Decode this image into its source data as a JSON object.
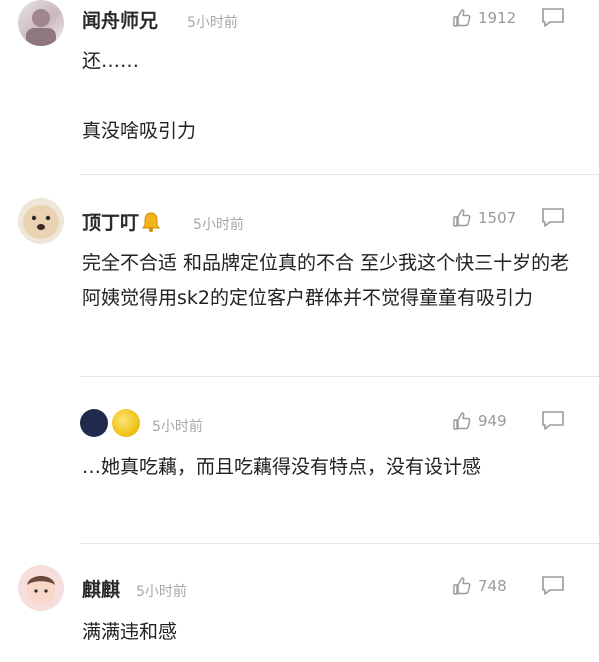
{
  "comments": [
    {
      "username": "闻舟师兄",
      "time": "5小时前",
      "likes": "1912",
      "text": [
        "还……",
        "真没啥吸引力"
      ]
    },
    {
      "username": "顶丁叮",
      "badge_icon": "bell-icon",
      "time": "5小时前",
      "likes": "1507",
      "text": [
        "完全不合适 和品牌定位真的不合 至少我这个快三十岁的老阿姨觉得用sk2的定位客户群体并不觉得童童有吸引力"
      ]
    },
    {
      "username": "",
      "time": "5小时前",
      "likes": "949",
      "text": [
        "…她真吃藕，而且吃藕得没有特点，没有设计感"
      ]
    },
    {
      "username": "麒麒",
      "time": "5小时前",
      "likes": "748",
      "text": [
        "满满违和感"
      ]
    }
  ],
  "icons": {
    "like": "thumbs-up-icon",
    "reply": "comment-bubble-icon"
  },
  "colors": {
    "username": "#2a2a2a",
    "meta": "#a8a8a8",
    "divider": "#e6e6e6",
    "dot_dark": "#1f2a4d",
    "dot_yellow": "#f0c419"
  }
}
